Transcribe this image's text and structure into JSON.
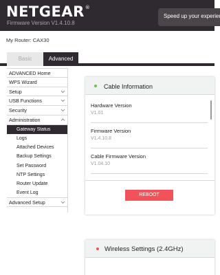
{
  "header": {
    "brand": "NETGEAR",
    "trademark": "®",
    "firmware_label": "Firmware Version V1.4.10.8",
    "promo_text": "Speed up your experience"
  },
  "router": {
    "label": "My Router: CAX30"
  },
  "tabs": [
    {
      "label": "Basic",
      "active": false
    },
    {
      "label": "Advanced",
      "active": true
    }
  ],
  "sidebar": {
    "items": [
      {
        "label": "ADVANCED Home",
        "chevron": ""
      },
      {
        "label": "WPS Wizard",
        "chevron": ""
      },
      {
        "label": "Setup",
        "chevron": "v"
      },
      {
        "label": "USB Functions",
        "chevron": "v"
      },
      {
        "label": "Security",
        "chevron": "v"
      },
      {
        "label": "Administration",
        "chevron": "^"
      }
    ],
    "sub_items": [
      {
        "label": "Gateway Status",
        "active": true
      },
      {
        "label": "Logs",
        "active": false
      },
      {
        "label": "Attached Devices",
        "active": false
      },
      {
        "label": "Backup Settings",
        "active": false
      },
      {
        "label": "Set Password",
        "active": false
      },
      {
        "label": "NTP Settings",
        "active": false
      },
      {
        "label": "Router Update",
        "active": false
      },
      {
        "label": "Event Log",
        "active": false
      }
    ],
    "bottom_item": {
      "label": "Advanced Setup",
      "chevron": "v"
    }
  },
  "cable_card": {
    "title": "Cable Information",
    "status_color": "#6ec246",
    "items": [
      {
        "label": "Hardware Version",
        "value": "V1.01"
      },
      {
        "label": "Firmware Version",
        "value": "V1.4.10.8"
      },
      {
        "label": "Cable Firmware Version",
        "value": "V1.04.10"
      }
    ],
    "reboot_label": "REBOOT"
  },
  "wireless_card": {
    "title": "Wireless Settings (2.4GHz)",
    "status_color": "#f2525a"
  },
  "colors": {
    "header_bg": "#2f2a30",
    "accent": "#f2525a",
    "active_nav": "#2f2a30"
  }
}
